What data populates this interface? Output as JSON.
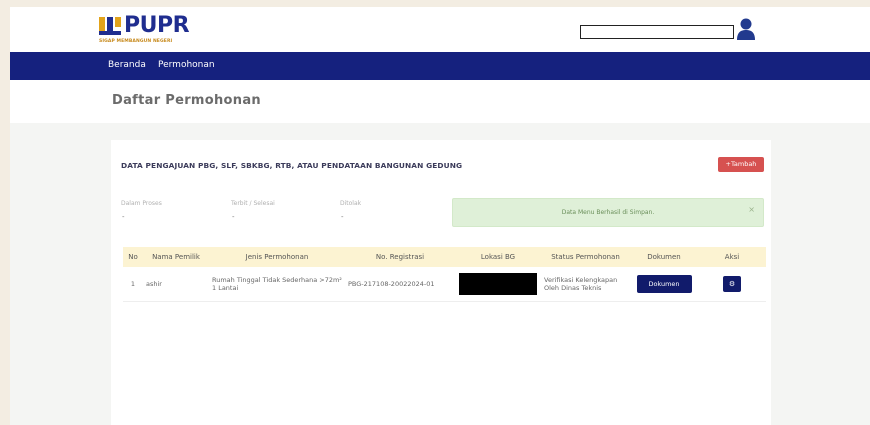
{
  "header": {
    "brand": "PUPR",
    "tagline": "SIGAP MEMBANGUN NEGERI",
    "search_value": ""
  },
  "nav": {
    "items": [
      {
        "label": "Beranda"
      },
      {
        "label": "Permohonan"
      }
    ]
  },
  "page": {
    "title": "Daftar Permohonan"
  },
  "card": {
    "title": "DATA PENGAJUAN PBG, SLF, SBKBG, RTB, ATAU PENDATAAN BANGUNAN GEDUNG",
    "add_label": "+Tambah"
  },
  "stats": [
    {
      "label": "Dalam Proses",
      "value": "-"
    },
    {
      "label": "Terbit / Selesai",
      "value": "-"
    },
    {
      "label": "Ditolak",
      "value": "-"
    }
  ],
  "alert": {
    "message": "Data Menu Berhasil di Simpan.",
    "close": "×"
  },
  "table": {
    "headers": [
      "No",
      "Nama Pemilik",
      "Jenis Permohonan",
      "No. Registrasi",
      "Lokasi BG",
      "Status Permohonan",
      "Dokumen",
      "Aksi"
    ],
    "rows": [
      {
        "no": "1",
        "owner": "ashir",
        "type": "Rumah Tinggal Tidak Sederhana >72m² 1 Lantai",
        "registration": "PBG-217108-20022024-01",
        "location": "",
        "status": "Verifikasi Kelengkapan Oleh Dinas Teknis",
        "doc_label": "Dokumen",
        "action_icon": "gear-icon",
        "action_glyph": "⚙"
      }
    ]
  },
  "colors": {
    "navbar": "#15217e",
    "button_primary": "#111b6b",
    "button_add": "#d65150",
    "alert_bg": "#dff0d8",
    "table_header_bg": "#fcf3d2"
  }
}
